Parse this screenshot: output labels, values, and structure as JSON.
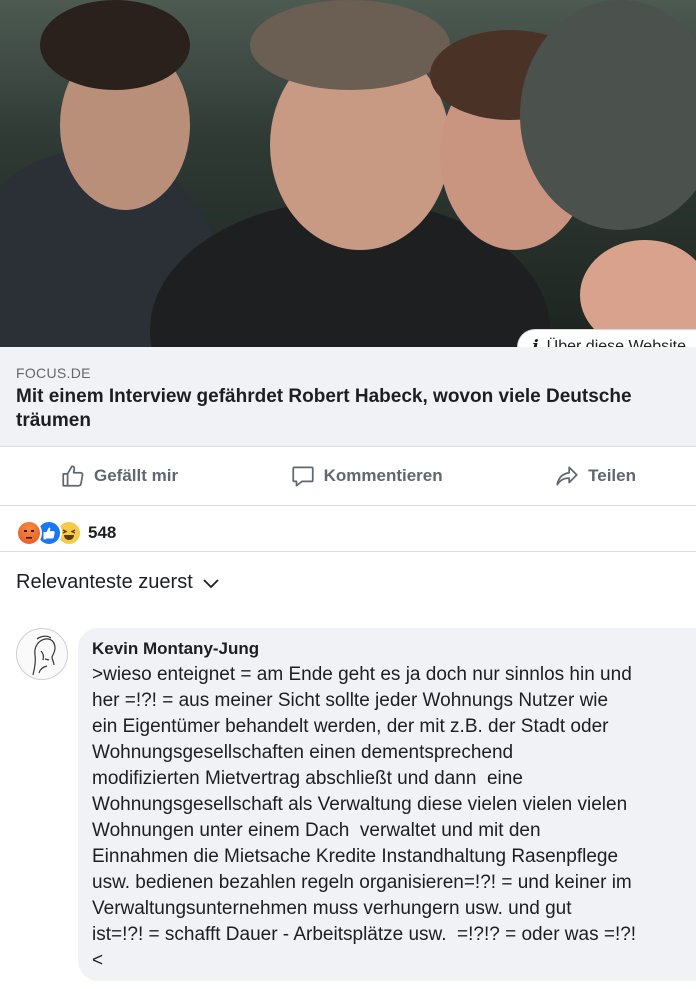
{
  "link": {
    "about_label": "Über diese Website",
    "domain": "FOCUS.DE",
    "title": "Mit einem Interview gefährdet Robert Habeck, wovon viele Deutsche träumen"
  },
  "actions": {
    "like": "Gefällt mir",
    "comment": "Kommentieren",
    "share": "Teilen"
  },
  "reactions": {
    "count": "548",
    "icons": [
      "angry-icon",
      "like-icon",
      "haha-icon"
    ]
  },
  "sort": {
    "label": "Relevanteste zuerst"
  },
  "comment": {
    "author": "Kevin Montany-Jung",
    "text": ">wieso enteignet = am Ende geht es ja doch nur sinnlos hin und\nher =!?! = aus meiner Sicht sollte jeder Wohnungs Nutzer wie\nein Eigentümer behandelt werden, der mit z.B. der Stadt oder\nWohnungsgesellschaften einen dementsprechend\nmodifizierten Mietvertrag abschließt und dann  eine\nWohnungsgesellschaft als Verwaltung diese vielen vielen vielen\nWohnungen unter einem Dach  verwaltet und mit den\nEinnahmen die Mietsache Kredite Instandhaltung Rasenpflege\nusw. bedienen bezahlen regeln organisieren=!?! = und keiner im\nVerwaltungsunternehmen muss verhungern usw. und gut\nist=!?! = schafft Dauer - Arbeitsplätze usw.  =!?!? = oder was =!?!\n<"
  },
  "colors": {
    "accent": "#1877f2",
    "bubble": "#f0f2f5",
    "muted_text": "#65676b"
  }
}
